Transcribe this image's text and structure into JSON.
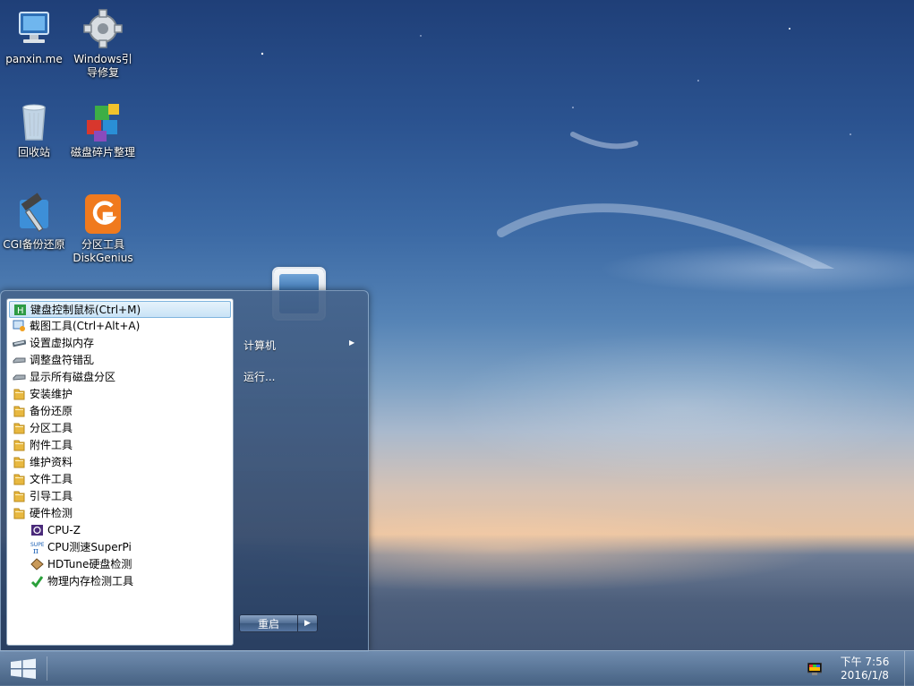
{
  "desktop": {
    "icons": [
      {
        "label": "panxin.me",
        "icon": "computer-icon"
      },
      {
        "label": "Windows引\n导修复",
        "icon": "gear-icon"
      },
      {
        "label": "回收站",
        "icon": "recycle-bin-icon"
      },
      {
        "label": "磁盘碎片整理",
        "icon": "defrag-cubes-icon"
      },
      {
        "label": "CGI备份还原",
        "icon": "cgi-hammer-icon"
      },
      {
        "label": "分区工具\nDiskGenius",
        "icon": "diskgenius-icon"
      }
    ]
  },
  "start_menu": {
    "programs": [
      {
        "label": "键盘控制鼠标(Ctrl+M)",
        "icon": "keyboard-mouse-icon",
        "selected": true
      },
      {
        "label": "截图工具(Ctrl+Alt+A)",
        "icon": "screenshot-icon"
      },
      {
        "label": "设置虚拟内存",
        "icon": "memory-icon"
      },
      {
        "label": "调整盘符错乱",
        "icon": "drive-icon"
      },
      {
        "label": "显示所有磁盘分区",
        "icon": "drive-icon"
      },
      {
        "label": "安装维护",
        "icon": "folder-icon"
      },
      {
        "label": "备份还原",
        "icon": "folder-icon"
      },
      {
        "label": "分区工具",
        "icon": "folder-icon"
      },
      {
        "label": "附件工具",
        "icon": "folder-icon"
      },
      {
        "label": "维护资料",
        "icon": "folder-icon"
      },
      {
        "label": "文件工具",
        "icon": "folder-icon"
      },
      {
        "label": "引导工具",
        "icon": "folder-icon"
      },
      {
        "label": "硬件检测",
        "icon": "folder-icon"
      },
      {
        "label": "CPU-Z",
        "icon": "cpuz-icon",
        "indent": true
      },
      {
        "label": "CPU测速SuperPi",
        "icon": "superpi-icon",
        "indent": true
      },
      {
        "label": "HDTune硬盘检测",
        "icon": "hdtune-icon",
        "indent": true
      },
      {
        "label": "物理内存检测工具",
        "icon": "memtest-icon",
        "indent": true
      }
    ],
    "right": {
      "computer": "计算机",
      "run": "运行..."
    },
    "restart_label": "重启",
    "restart_arrow": "▶"
  },
  "taskbar": {
    "clock_time": "下午 7:56",
    "clock_date": "2016/1/8"
  },
  "colors": {
    "selection": "#c9e3f6",
    "folder": "#e8b840"
  }
}
